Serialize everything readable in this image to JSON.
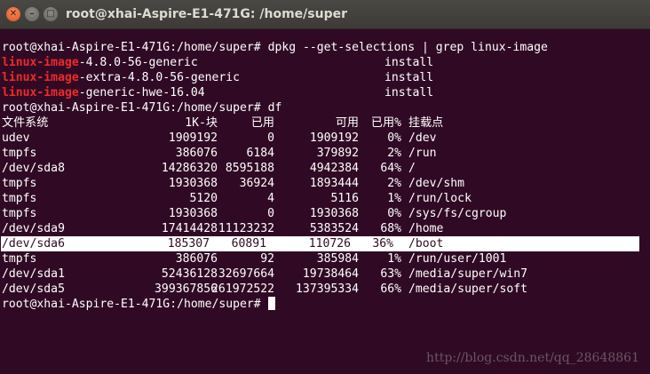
{
  "window": {
    "title": "root@xhai-Aspire-E1-471G: /home/super",
    "close_glyph": "✕",
    "minimize_glyph": "–",
    "maximize_glyph": "□"
  },
  "commands": {
    "cmd1_prompt": "root@xhai-Aspire-E1-471G:/home/super# ",
    "cmd1_text": "dpkg --get-selections | grep linux-image",
    "cmd2_prompt": "root@xhai-Aspire-E1-471G:/home/super# ",
    "cmd2_text": "df",
    "prompt3": "root@xhai-Aspire-E1-471G:/home/super# "
  },
  "dpkg_output": [
    {
      "match": "linux-image",
      "rest": "-4.8.0-56-generic",
      "status": "install"
    },
    {
      "match": "linux-image",
      "rest": "-extra-4.8.0-56-generic",
      "status": "install"
    },
    {
      "match": "linux-image",
      "rest": "-generic-hwe-16.04",
      "status": "install"
    }
  ],
  "df": {
    "headers": {
      "fs": "文件系统",
      "blocks": "1K-块",
      "used": "已用",
      "avail": "可用",
      "pct": "已用%",
      "mount": "挂载点"
    },
    "rows": [
      {
        "fs": "udev",
        "blocks": "1909192",
        "used": "0",
        "avail": "1909192",
        "pct": "0%",
        "mount": "/dev"
      },
      {
        "fs": "tmpfs",
        "blocks": "386076",
        "used": "6184",
        "avail": "379892",
        "pct": "2%",
        "mount": "/run"
      },
      {
        "fs": "/dev/sda8",
        "blocks": "14286320",
        "used": "8595188",
        "avail": "4942384",
        "pct": "64%",
        "mount": "/"
      },
      {
        "fs": "tmpfs",
        "blocks": "1930368",
        "used": "36924",
        "avail": "1893444",
        "pct": "2%",
        "mount": "/dev/shm"
      },
      {
        "fs": "tmpfs",
        "blocks": "5120",
        "used": "4",
        "avail": "5116",
        "pct": "1%",
        "mount": "/run/lock"
      },
      {
        "fs": "tmpfs",
        "blocks": "1930368",
        "used": "0",
        "avail": "1930368",
        "pct": "0%",
        "mount": "/sys/fs/cgroup"
      },
      {
        "fs": "/dev/sda9",
        "blocks": "17414428",
        "used": "11123232",
        "avail": "5383524",
        "pct": "68%",
        "mount": "/home"
      },
      {
        "fs": "/dev/sda6",
        "blocks": "185307",
        "used": "60891",
        "avail": "110726",
        "pct": "36%",
        "mount": "/boot"
      },
      {
        "fs": "tmpfs",
        "blocks": "386076",
        "used": "92",
        "avail": "385984",
        "pct": "1%",
        "mount": "/run/user/1001"
      },
      {
        "fs": "/dev/sda1",
        "blocks": "52436128",
        "used": "32697664",
        "avail": "19738464",
        "pct": "63%",
        "mount": "/media/super/win7"
      },
      {
        "fs": "/dev/sda5",
        "blocks": "399367856",
        "used": "261972522",
        "avail": "137395334",
        "pct": "66%",
        "mount": "/media/super/soft"
      }
    ]
  },
  "watermark": "http://blog.csdn.net/qq_28648861",
  "colors": {
    "background": "#300a24",
    "text": "#ffffff",
    "grep_match": "#ef2929",
    "titlebar": "#3c3b37"
  }
}
